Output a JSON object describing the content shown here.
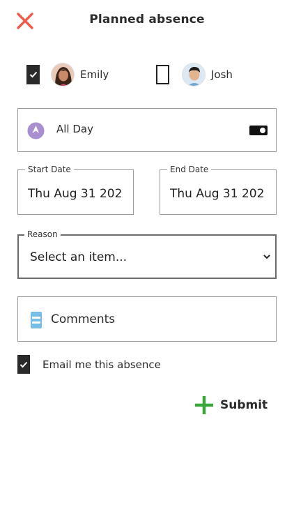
{
  "header": {
    "title": "Planned absence",
    "close_icon": "close-icon",
    "close_color": "#ef5a4a"
  },
  "members": [
    {
      "name": "Emily",
      "checked": true,
      "avatar_icon": "avatar-girl"
    },
    {
      "name": "Josh",
      "checked": false,
      "avatar_icon": "avatar-boy"
    }
  ],
  "all_day": {
    "label": "All Day",
    "icon": "clock-icon",
    "icon_color": "#a98fd0",
    "toggle_on": true
  },
  "start_date": {
    "legend": "Start Date",
    "value": "Thu Aug 31 202"
  },
  "end_date": {
    "legend": "End Date",
    "value": "Thu Aug 31 202"
  },
  "reason": {
    "legend": "Reason",
    "selected": "Select an item..."
  },
  "comments": {
    "placeholder": "Comments",
    "icon": "comment-icon",
    "icon_color": "#76bde8"
  },
  "email": {
    "label": "Email me this absence",
    "checked": true
  },
  "submit": {
    "label": "Submit",
    "icon": "plus-icon",
    "icon_color": "#3aa53a"
  }
}
